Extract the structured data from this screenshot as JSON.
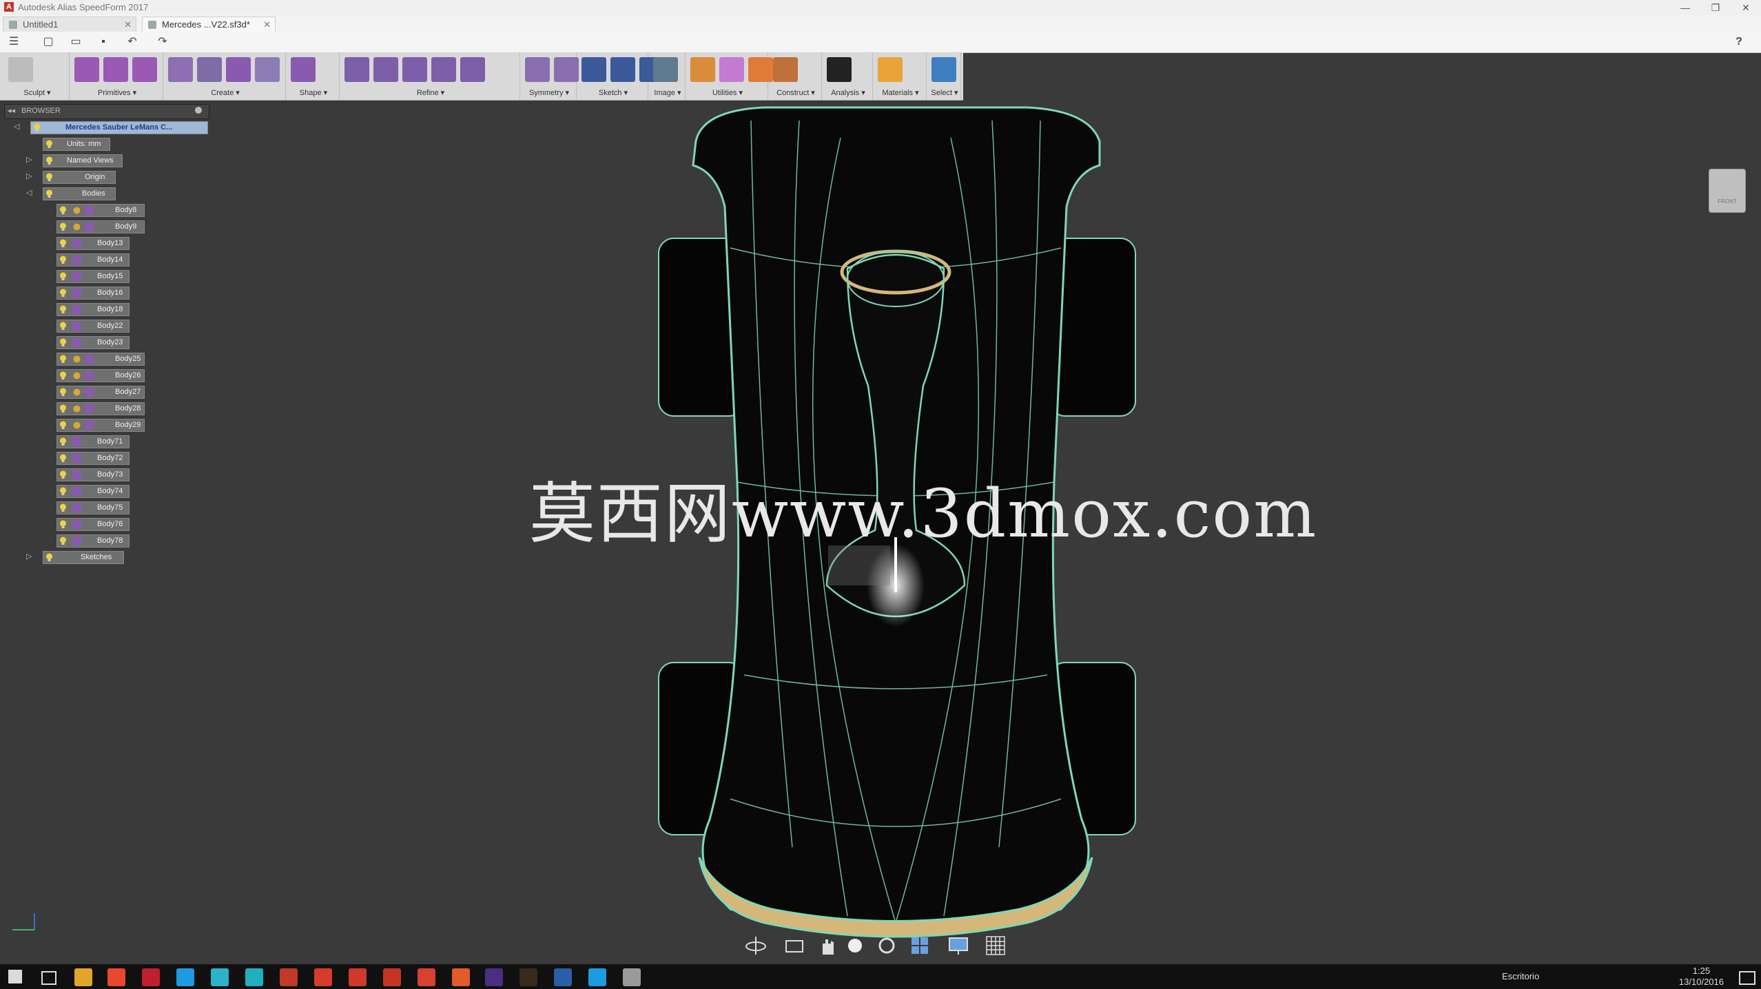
{
  "window": {
    "title": "Autodesk Alias SpeedForm 2017",
    "minimize": "—",
    "restore": "❐",
    "close": "✕"
  },
  "tabs": [
    {
      "label": "Untitled1",
      "close": "✕"
    },
    {
      "label": "Mercedes ...V22.sf3d*",
      "close": "✕"
    }
  ],
  "qat": {
    "help": "?"
  },
  "ribbon": [
    {
      "label": "Sculpt ▾",
      "colors": [
        "#bcbcbc"
      ]
    },
    {
      "label": "Primitives ▾",
      "colors": [
        "#9b59b6",
        "#9b59b6",
        "#9b59b6"
      ]
    },
    {
      "label": "Create ▾",
      "colors": [
        "#8e6fb3",
        "#7d6ca8",
        "#8a5ab0",
        "#8d7cb6"
      ]
    },
    {
      "label": "Shape ▾",
      "colors": [
        "#8a5ab0"
      ]
    },
    {
      "label": "Refine ▾",
      "colors": [
        "#7d5ea8",
        "#7d5ea8",
        "#7d5ea8",
        "#7d5ea8",
        "#7d5ea8"
      ]
    },
    {
      "label": "Symmetry ▾",
      "colors": [
        "#8a6fb0",
        "#8a6fb0"
      ]
    },
    {
      "label": "Sketch ▾",
      "colors": [
        "#3c5a9a",
        "#3c5a9a",
        "#3c5a9a"
      ]
    },
    {
      "label": "Image ▾",
      "colors": [
        "#5f7a8f"
      ]
    },
    {
      "label": "Utilities ▾",
      "colors": [
        "#d98c3a",
        "#c47ad1",
        "#e07b39"
      ]
    },
    {
      "label": "Construct ▾",
      "colors": [
        "#c0703a"
      ]
    },
    {
      "label": "Analysis ▾",
      "colors": [
        "#222222"
      ]
    },
    {
      "label": "Materials ▾",
      "colors": [
        "#e8a33a"
      ]
    },
    {
      "label": "Select ▾",
      "colors": [
        "#3d7fc1"
      ]
    }
  ],
  "browser": {
    "title": "BROWSER",
    "root": "Mercedes Sauber LeMans C...",
    "units": "Units: mm",
    "named_views": "Named Views",
    "origin": "Origin",
    "bodies_label": "Bodies",
    "bodies": [
      "Body8",
      "Body9",
      "Body13",
      "Body14",
      "Body15",
      "Body16",
      "Body18",
      "Body22",
      "Body23",
      "Body25",
      "Body26",
      "Body27",
      "Body28",
      "Body29",
      "Body71",
      "Body72",
      "Body73",
      "Body74",
      "Body75",
      "Body76",
      "Body78"
    ],
    "sketches": "Sketches"
  },
  "viewcube": {
    "label": "FRONT"
  },
  "watermark": "莫西网www.3dmox.com",
  "taskbar": {
    "search_label": "Escritorio",
    "time": "1:25",
    "date": "13/10/2016"
  },
  "colors": {
    "accent": "#3d7fc1",
    "wire": "#7fd8b4",
    "rim": "#d6b77a"
  }
}
